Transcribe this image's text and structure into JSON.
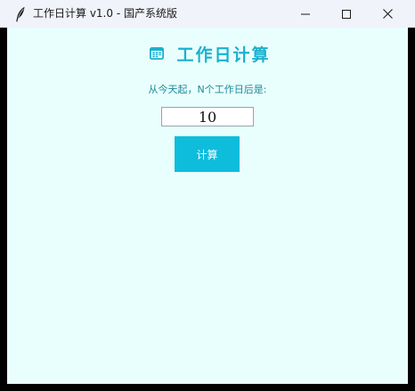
{
  "window": {
    "title": "工作日计算  v1.0  -  国产系统版",
    "app_icon": "feather-icon",
    "controls": {
      "minimize_icon": "minimize-icon",
      "maximize_icon": "maximize-icon",
      "close_icon": "close-icon"
    }
  },
  "main": {
    "heading_icon": "calendar-icon",
    "heading": "工作日计算",
    "prompt": "从今天起，N个工作日后是:",
    "input": {
      "value": "10"
    },
    "calculate_label": "计算"
  },
  "colors": {
    "titlebar_bg": "#f0f3f9",
    "client_bg": "#e9fffe",
    "accent": "#1ab1d0",
    "button_bg": "#0ebcdc",
    "prompt_text": "#1d8a9a"
  }
}
